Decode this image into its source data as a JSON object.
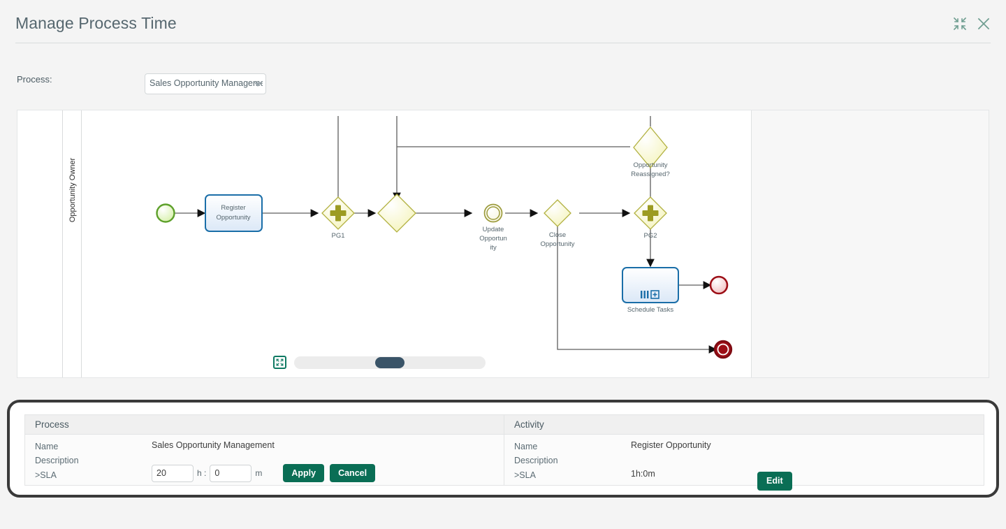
{
  "header": {
    "title": "Manage Process Time",
    "actions": [
      {
        "name": "collapse-icon",
        "label": "Collapse"
      },
      {
        "name": "close-icon",
        "label": "Close"
      }
    ]
  },
  "process_selector": {
    "label": "Process:",
    "selected": "Sales Opportunity Management",
    "caret": "chevron-down-icon"
  },
  "diagram": {
    "lane_label": "Opportunity Owner",
    "nodes": [
      {
        "id": "start",
        "type": "start-event",
        "label": ""
      },
      {
        "id": "register",
        "type": "task",
        "label": "Register Opportunity"
      },
      {
        "id": "pg1",
        "type": "parallel-gateway",
        "label": "PG1"
      },
      {
        "id": "gw_mid",
        "type": "exclusive-gateway",
        "label": ""
      },
      {
        "id": "update",
        "type": "intermediate-event",
        "label": "Update Opportunity"
      },
      {
        "id": "close",
        "type": "exclusive-gateway",
        "label": "Close Opportunity"
      },
      {
        "id": "reassigned",
        "type": "exclusive-gateway",
        "label": "Opportunity Reassigned?"
      },
      {
        "id": "pg2",
        "type": "parallel-gateway",
        "label": "PG2"
      },
      {
        "id": "schedule",
        "type": "subprocess-task",
        "label": "Schedule Tasks"
      },
      {
        "id": "end1",
        "type": "end-event",
        "label": ""
      },
      {
        "id": "end2",
        "type": "terminate-end-event",
        "label": ""
      }
    ],
    "zoom": {
      "fit_icon": "fit-to-screen-icon",
      "slider_value": 42
    }
  },
  "details": {
    "process": {
      "header": "Process",
      "labels": {
        "name": "Name",
        "description": "Description",
        "sla": ">SLA"
      },
      "name_value": "Sales Opportunity Management",
      "description_value": "",
      "sla_hours": "20",
      "sla_minutes": "0",
      "unit_h": "h :",
      "unit_m": "m",
      "apply_label": "Apply",
      "cancel_label": "Cancel"
    },
    "activity": {
      "header": "Activity",
      "labels": {
        "name": "Name",
        "description": "Description",
        "sla": ">SLA"
      },
      "name_value": "Register Opportunity",
      "description_value": "",
      "sla_value": "1h:0m",
      "edit_label": "Edit"
    }
  },
  "colors": {
    "accent_green": "#0a6e55",
    "title_gray": "#56676f",
    "gateway_yellow": "#fbfbd0",
    "gateway_stroke": "#b2b140",
    "task_blue": "#1a6ea8",
    "end_red": "#9c0e16"
  }
}
